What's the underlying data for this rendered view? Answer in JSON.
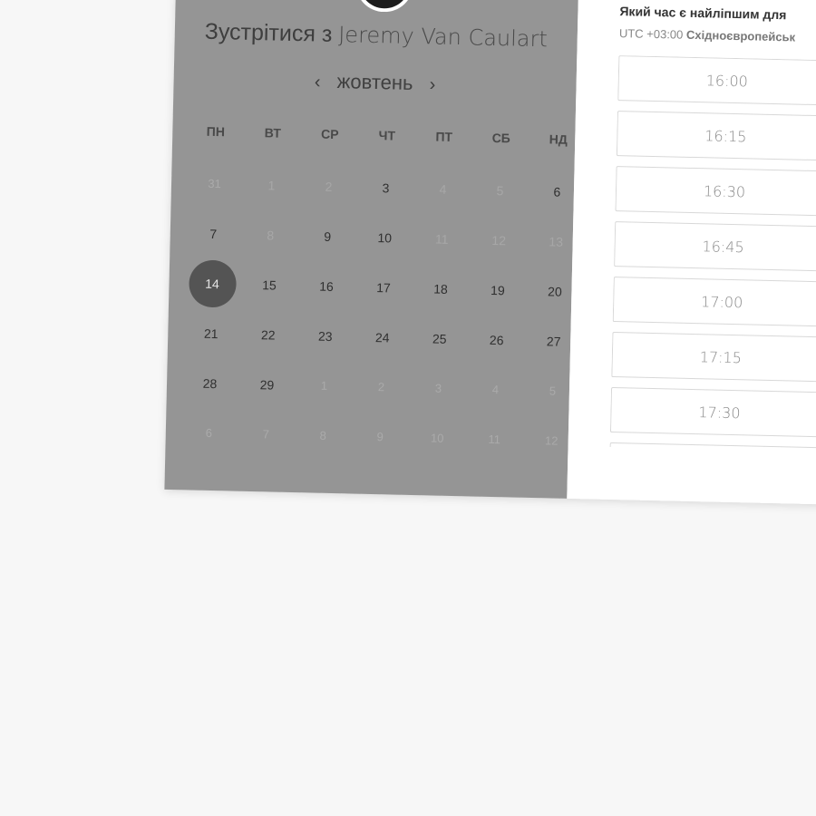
{
  "header": {
    "title_prefix": "Зустрітися з",
    "name": "Jeremy Van Caulart"
  },
  "calendar": {
    "month": "жовтень",
    "prev_icon": "chevron-left-icon",
    "next_icon": "chevron-right-icon",
    "weekdays": [
      "ПН",
      "ВТ",
      "СР",
      "ЧТ",
      "ПТ",
      "СБ",
      "НД"
    ],
    "weeks": [
      [
        "31",
        "1",
        "2",
        "3",
        "4",
        "5",
        "6"
      ],
      [
        "7",
        "8",
        "9",
        "10",
        "11",
        "12",
        "13"
      ],
      [
        "14",
        "15",
        "16",
        "17",
        "18",
        "19",
        "20"
      ],
      [
        "21",
        "22",
        "23",
        "24",
        "25",
        "26",
        "27"
      ],
      [
        "28",
        "29",
        "1",
        "2",
        "3",
        "4",
        "5"
      ],
      [
        "6",
        "7",
        "8",
        "9",
        "10",
        "11",
        "12"
      ]
    ],
    "selected": "14"
  },
  "times": {
    "prompt": "Який час є найліпшим для",
    "timezone_offset": "UTC +03:00",
    "timezone_name": "Східноєвропейськ",
    "slots": [
      "16:00",
      "16:15",
      "16:30",
      "16:45",
      "17:00",
      "17:15",
      "17:30",
      ""
    ]
  }
}
